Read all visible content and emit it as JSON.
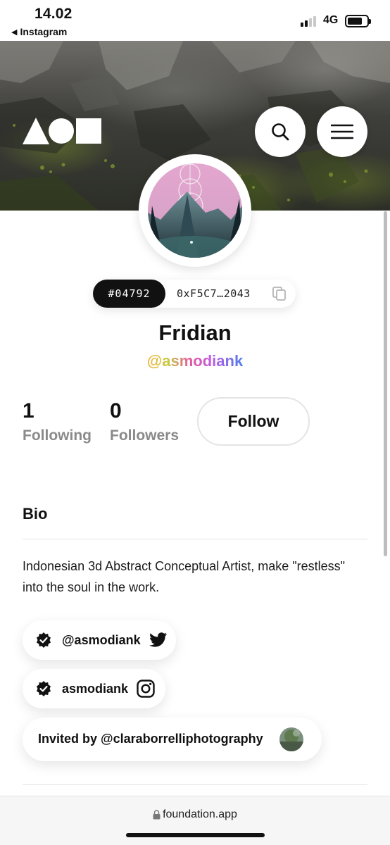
{
  "status_bar": {
    "time": "14.02",
    "back_app": "Instagram",
    "network": "4G"
  },
  "cover": {
    "search_icon": "search-icon",
    "menu_icon": "hamburger-menu-icon"
  },
  "profile": {
    "id_number": "#04792",
    "wallet_address": "0xF5C7…2043",
    "display_name": "Fridian",
    "username": "@asmodiank",
    "following_count": "1",
    "following_label": "Following",
    "followers_count": "0",
    "followers_label": "Followers",
    "follow_label": "Follow"
  },
  "bio": {
    "heading": "Bio",
    "text": "Indonesian 3d Abstract Conceptual Artist, make \"restless\" into the soul in the work."
  },
  "links": {
    "twitter_handle": "@asmodiank",
    "instagram_handle": "asmodiank",
    "invited_by": "Invited by @claraborrelliphotography"
  },
  "browser": {
    "url": "foundation.app"
  },
  "colors": {
    "accent": "#111111",
    "cover_moss": "#6e8228",
    "avatar_sky": "#e4a6cf"
  }
}
